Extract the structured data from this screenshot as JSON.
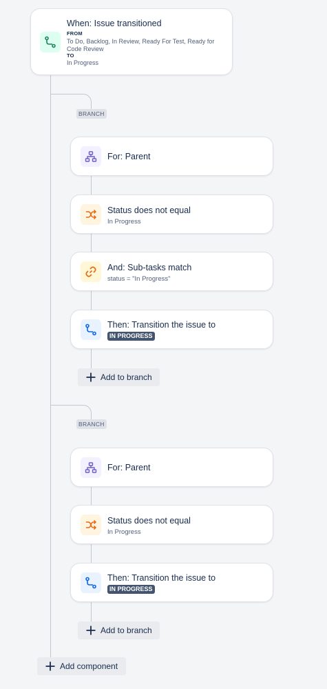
{
  "trigger": {
    "title": "When: Issue transitioned",
    "from_label": "FROM",
    "from_value": "To Do, Backlog, In Review, Ready For Test, Ready for Code Review",
    "to_label": "TO",
    "to_value": "In Progress",
    "icon": "transition-icon"
  },
  "branches": [
    {
      "label": "BRANCH",
      "for": {
        "title": "For: Parent",
        "icon": "hierarchy-icon"
      },
      "condition": {
        "title": "Status does not equal",
        "sub": "In Progress",
        "icon": "shuffle-icon"
      },
      "and": {
        "title": "And: Sub-tasks match",
        "sub": "status = \"In Progress\"",
        "icon": "link-icon"
      },
      "then": {
        "title": "Then: Transition the issue to",
        "lozenge": "IN PROGRESS",
        "icon": "transition-icon"
      },
      "add_button": "Add to branch"
    },
    {
      "label": "BRANCH",
      "for": {
        "title": "For: Parent",
        "icon": "hierarchy-icon"
      },
      "condition": {
        "title": "Status does not equal",
        "sub": "In Progress",
        "icon": "shuffle-icon"
      },
      "then": {
        "title": "Then: Transition the issue to",
        "lozenge": "IN PROGRESS",
        "icon": "transition-icon"
      },
      "add_button": "Add to branch"
    }
  ],
  "add_component": "Add component",
  "colors": {
    "green": "#1f845a",
    "purple": "#6e5dc6",
    "orange": "#e56910",
    "yellow": "#b38600",
    "blue": "#0c66e4",
    "lozenge": "#44546f"
  }
}
